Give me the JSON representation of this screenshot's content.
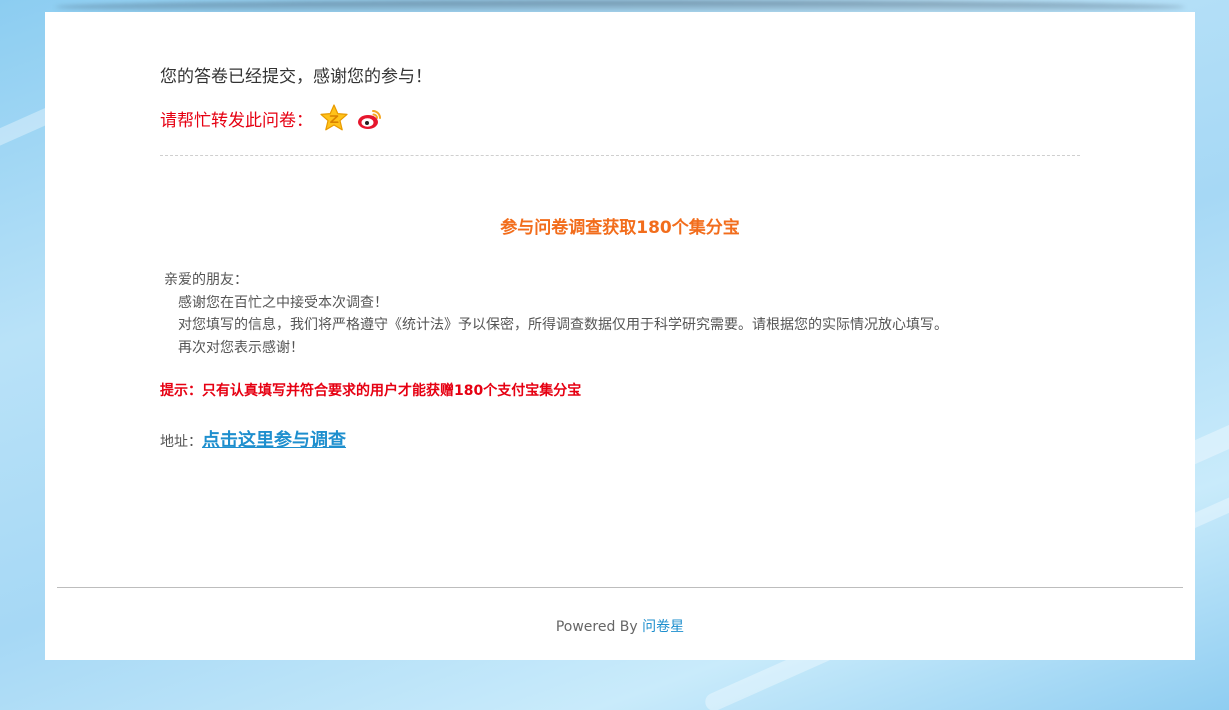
{
  "confirmation": {
    "message": "您的答卷已经提交，感谢您的参与！"
  },
  "share": {
    "label": "请帮忙转发此问卷：",
    "icons": [
      "qq-zone-star-icon",
      "sina-weibo-icon"
    ]
  },
  "promo": {
    "title": "参与问卷调查获取180个集分宝",
    "greeting": "亲爱的朋友：",
    "lines": [
      "感谢您在百忙之中接受本次调查！",
      "对您填写的信息，我们将严格遵守《统计法》予以保密，所得调查数据仅用于科学研究需要。请根据您的实际情况放心填写。",
      "再次对您表示感谢！"
    ],
    "tip": "提示：只有认真填写并符合要求的用户才能获赠180个支付宝集分宝",
    "address_label": "地址：",
    "link_text": "点击这里参与调查"
  },
  "footer": {
    "powered_by": "Powered By",
    "brand": "问卷星"
  },
  "colors": {
    "accent_red": "#e60012",
    "accent_orange": "#f26d1c",
    "link_blue": "#1e8fce",
    "background_sky": "#a6d8f5"
  }
}
